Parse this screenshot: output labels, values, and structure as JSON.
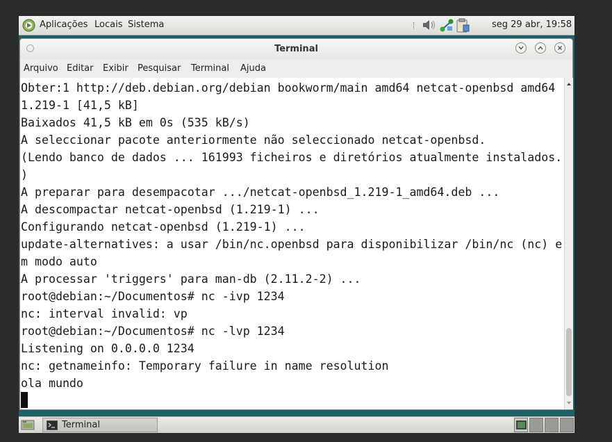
{
  "top_panel": {
    "menus": [
      "Aplicações",
      "Locais",
      "Sistema"
    ],
    "clock": "seg 29 abr, 19:58",
    "icons": [
      "applications-icon",
      "volume-icon",
      "network-icon",
      "clipboard-icon"
    ]
  },
  "window": {
    "title": "Terminal",
    "menu": [
      "Arquivo",
      "Editar",
      "Exibir",
      "Pesquisar",
      "Terminal",
      "Ajuda"
    ]
  },
  "terminal": {
    "lines": [
      "Obter:1 http://deb.debian.org/debian bookworm/main amd64 netcat-openbsd amd64",
      "1.219-1 [41,5 kB]",
      "Baixados 41,5 kB em 0s (535 kB/s)",
      "A seleccionar pacote anteriormente não seleccionado netcat-openbsd.",
      "(Lendo banco de dados ... 161993 ficheiros e diretórios atualmente instalados.",
      ")",
      "A preparar para desempacotar .../netcat-openbsd_1.219-1_amd64.deb ...",
      "A descompactar netcat-openbsd (1.219-1) ...",
      "Configurando netcat-openbsd (1.219-1) ...",
      "update-alternatives: a usar /bin/nc.openbsd para disponibilizar /bin/nc (nc) e",
      "m modo auto",
      "A processar 'triggers' para man-db (2.11.2-2) ...",
      "root@debian:~/Documentos# nc -ivp 1234",
      "nc: interval invalid: vp",
      "root@debian:~/Documentos# nc -lvp 1234",
      "Listening on 0.0.0.0 1234",
      "nc: getnameinfo: Temporary failure in name resolution",
      "ola mundo"
    ]
  },
  "bottom_panel": {
    "task_label": "Terminal"
  }
}
